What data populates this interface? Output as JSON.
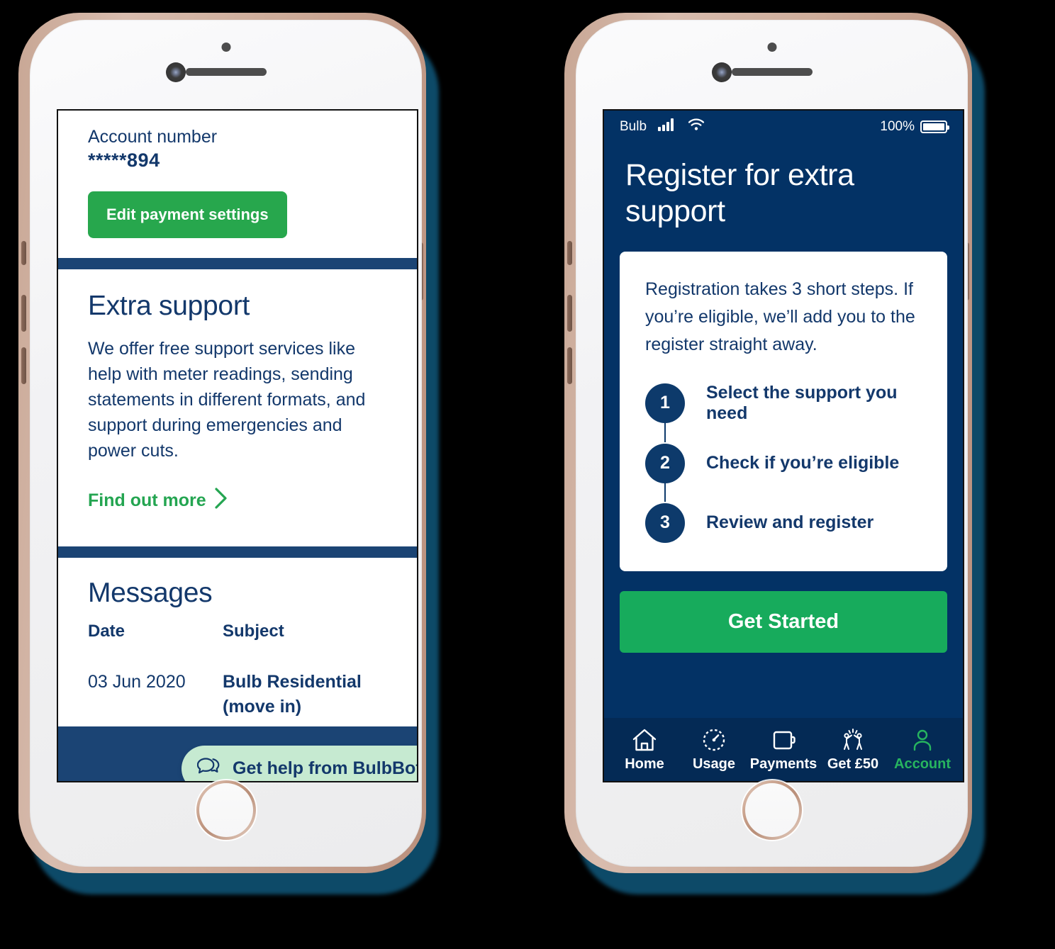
{
  "left_phone": {
    "account_card": {
      "label": "Account number",
      "value": "*****894",
      "edit_button": "Edit payment settings"
    },
    "support_card": {
      "title": "Extra support",
      "body": "We offer free support services like help with meter readings, sending statements in different formats, and support during emergencies and power cuts.",
      "link": "Find out more",
      "chevron": "›"
    },
    "messages_card": {
      "title": "Messages",
      "columns": [
        "Date",
        "Subject"
      ],
      "rows": [
        {
          "date": "03 Jun 2020",
          "subject_line1": "Bulb Residential",
          "subject_line2": "(move in)"
        }
      ]
    },
    "bulbbot_chip": {
      "label": "Get help from BulbBot",
      "icon": "chat-bubbles-icon"
    }
  },
  "right_phone": {
    "status_bar": {
      "carrier": "Bulb",
      "signal_icon": "signal-bars-icon",
      "wifi_icon": "wifi-icon",
      "battery_percent": "100%",
      "battery_icon": "battery-icon"
    },
    "title": "Register for extra support",
    "intro": "Registration takes 3 short steps. If you’re eligible, we’ll add you to the register straight away.",
    "steps": [
      {
        "number": "1",
        "label": "Select the support you need"
      },
      {
        "number": "2",
        "label": "Check if you’re eligible"
      },
      {
        "number": "3",
        "label": "Review and register"
      }
    ],
    "cta_button": "Get Started",
    "tabs": [
      {
        "label": "Home",
        "icon": "house-icon",
        "active": false
      },
      {
        "label": "Usage",
        "icon": "speedometer-icon",
        "active": false
      },
      {
        "label": "Payments",
        "icon": "wallet-icon",
        "active": false
      },
      {
        "label": "Get £50",
        "icon": "high-five-icon",
        "active": false
      },
      {
        "label": "Account",
        "icon": "person-icon",
        "active": true
      }
    ]
  },
  "colors": {
    "brand_navy": "#13386b",
    "screen_navy_left": "#1b4474",
    "screen_navy_right": "#033265",
    "tabbar_navy": "#042a55",
    "green": "#17ab5c",
    "green_button": "#27a74d",
    "green_link": "#24a551",
    "chip_green": "#c6ead1",
    "accent_active": "#27b45f"
  }
}
